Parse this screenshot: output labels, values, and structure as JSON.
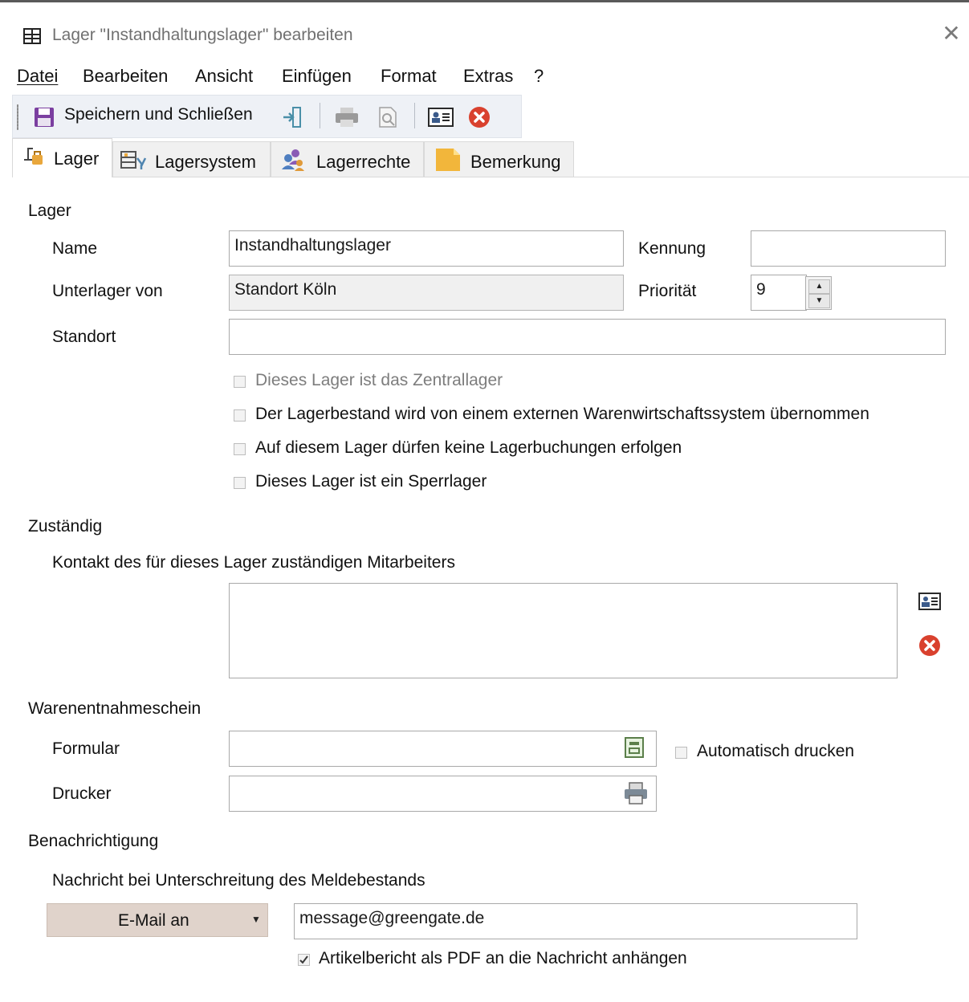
{
  "window": {
    "title": "Lager \"Instandhaltungslager\" bearbeiten",
    "close_glyph": "✕"
  },
  "menu": [
    "Datei",
    "Bearbeiten",
    "Ansicht",
    "Einfügen",
    "Format",
    "Extras",
    "?"
  ],
  "toolbar": {
    "save_close_label": "Speichern und Schließen",
    "icons": [
      "save-icon",
      "exit-icon",
      "print-icon",
      "print-preview-icon",
      "contact-card-icon",
      "cancel-icon"
    ]
  },
  "tabs": [
    {
      "label": "Lager",
      "icon": "warehouse-icon",
      "active": true
    },
    {
      "label": "Lagersystem",
      "icon": "warehouse-system-icon",
      "active": false
    },
    {
      "label": "Lagerrechte",
      "icon": "users-rights-icon",
      "active": false
    },
    {
      "label": "Bemerkung",
      "icon": "note-icon",
      "active": false
    }
  ],
  "lager": {
    "section_title": "Lager",
    "name_label": "Name",
    "name_value": "Instandhaltungslager",
    "kennung_label": "Kennung",
    "kennung_value": "",
    "unterlager_label": "Unterlager von",
    "unterlager_value": "Standort Köln",
    "prioritaet_label": "Priorität",
    "prioritaet_value": "9",
    "standort_label": "Standort",
    "standort_value": "",
    "checkboxes": [
      {
        "label": "Dieses Lager ist das Zentrallager",
        "checked": false,
        "disabled": true
      },
      {
        "label": "Der Lagerbestand wird von einem externen Warenwirtschaftssystem übernommen",
        "checked": false,
        "disabled": false
      },
      {
        "label": "Auf diesem Lager dürfen keine Lagerbuchungen erfolgen",
        "checked": false,
        "disabled": false
      },
      {
        "label": "Dieses Lager ist ein Sperrlager",
        "checked": false,
        "disabled": false
      }
    ]
  },
  "zustaendig": {
    "section_title": "Zuständig",
    "description": "Kontakt des für dieses Lager zuständigen Mitarbeiters",
    "contact_value": ""
  },
  "warenentnahme": {
    "section_title": "Warenentnahmeschein",
    "formular_label": "Formular",
    "formular_value": "",
    "drucker_label": "Drucker",
    "drucker_value": "",
    "auto_print_label": "Automatisch drucken",
    "auto_print_checked": false
  },
  "benachrichtigung": {
    "section_title": "Benachrichtigung",
    "description": "Nachricht bei Unterschreitung des Meldebestands",
    "mode_selected": "E-Mail an",
    "email_value": "message@greengate.de",
    "attach_label": "Artikelbericht als PDF an die Nachricht anhängen",
    "attach_checked": true
  },
  "colors": {
    "accent_red": "#d9412e",
    "toolbar_bg": "#eef1f6",
    "dropdown_bg": "#e0d3cb"
  }
}
